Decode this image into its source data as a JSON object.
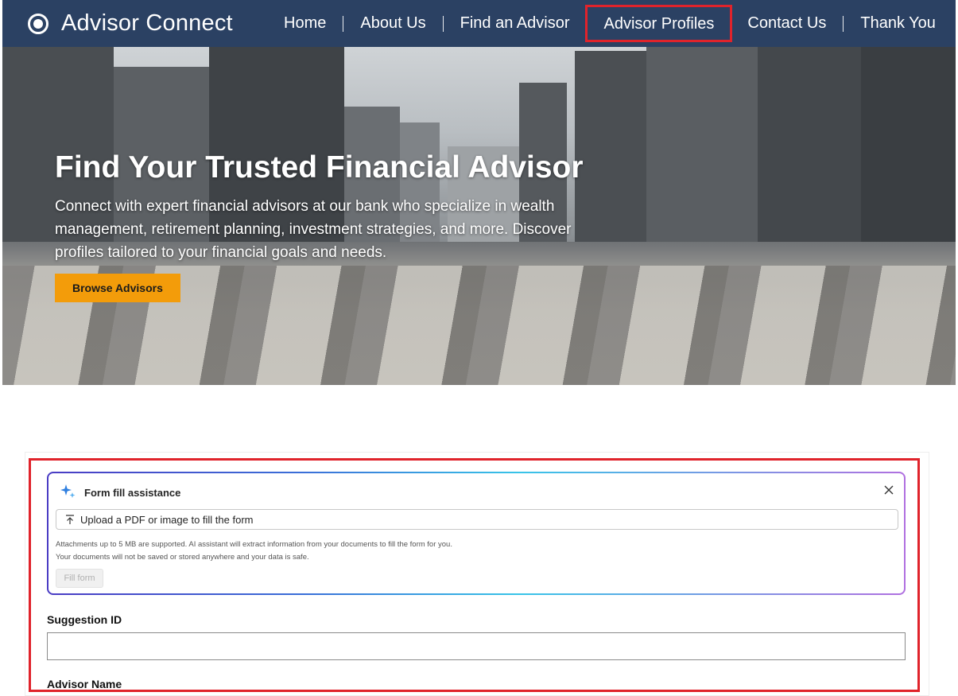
{
  "nav": {
    "brand": "Advisor Connect",
    "items": [
      {
        "label": "Home"
      },
      {
        "label": "About Us"
      },
      {
        "label": "Find an Advisor"
      },
      {
        "label": "Advisor Profiles"
      },
      {
        "label": "Contact Us"
      },
      {
        "label": "Thank You"
      }
    ]
  },
  "hero": {
    "title": "Find Your Trusted Financial Advisor",
    "subtitle": "Connect with expert financial advisors at our bank who specialize in wealth management, retirement planning, investment strategies, and more. Discover profiles tailored to your financial goals and needs.",
    "cta": "Browse Advisors"
  },
  "assist": {
    "title": "Form fill assistance",
    "upload_label": "Upload a PDF or image to fill the form",
    "note_line1": "Attachments up to 5 MB are supported. AI assistant will extract information from your documents to fill the form for you.",
    "note_line2": "Your documents will not be saved or stored anywhere and your data is safe.",
    "fill_button": "Fill form"
  },
  "form": {
    "suggestion_id_label": "Suggestion ID",
    "suggestion_id_value": "",
    "advisor_name_label": "Advisor Name"
  },
  "colors": {
    "nav_bg": "#2b4163",
    "cta_bg": "#f39c0a",
    "highlight": "#e0232b"
  }
}
